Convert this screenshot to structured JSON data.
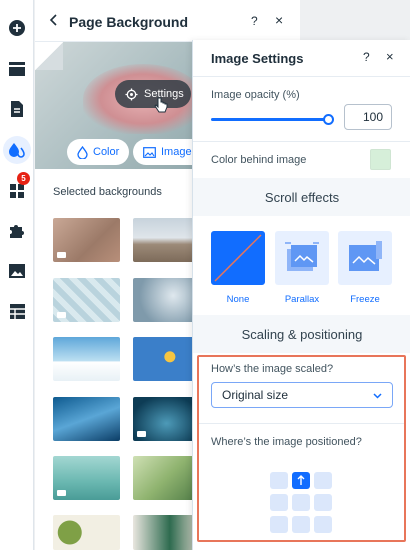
{
  "toolbar": {
    "items": [
      "add-elements",
      "sections",
      "pages",
      "site-design",
      "apps",
      "business",
      "media",
      "cms"
    ],
    "apps_badge": "5",
    "accent": "#116dff"
  },
  "bg_panel": {
    "title": "Page Background",
    "help": "?",
    "close": "×",
    "settings_label": "Settings",
    "color_label": "Color",
    "image_label": "Image",
    "section_label": "Selected backgrounds"
  },
  "image_settings": {
    "title": "Image Settings",
    "help": "?",
    "close": "×",
    "opacity_label": "Image opacity (%)",
    "opacity_value": "100",
    "opacity_fraction": 1.0,
    "color_behind_label": "Color behind image",
    "color_behind_value": "#d6efd9",
    "scroll_effects_title": "Scroll effects",
    "effects": [
      {
        "label": "None",
        "selected": true
      },
      {
        "label": "Parallax",
        "selected": false
      },
      {
        "label": "Freeze",
        "selected": false
      }
    ],
    "scaling_title": "Scaling & positioning",
    "scaled_question": "How’s the image scaled?",
    "scaled_value": "Original size",
    "positioned_question": "Where’s the image positioned?",
    "position_selected": "top-center",
    "highlight_color": "#e8755a"
  }
}
